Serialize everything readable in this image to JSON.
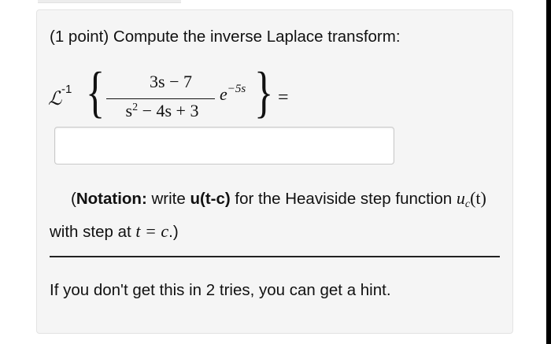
{
  "problem": {
    "prompt": "(1 point) Compute the inverse Laplace transform:",
    "operator": "ℒ",
    "operator_sup": "-1",
    "numerator": "3s − 7",
    "denominator_a": "s",
    "denominator_sup": "2",
    "denominator_b": " − 4s + 3",
    "exp_base": "e",
    "exp_power": "−5s",
    "equals": "="
  },
  "answer": {
    "value": "",
    "placeholder": ""
  },
  "notation": {
    "open": "(",
    "bold_label": "Notation:",
    "text1": " write ",
    "bold_code": "u(t-c)",
    "text2": " for the Heaviside step function ",
    "math_u": "u",
    "math_sub": "c",
    "math_arg": "(t)",
    "text3": " with step at ",
    "math_eq": "t = c",
    "text4": ".)"
  },
  "hint": {
    "text": "If you don't get this in 2 tries, you can get a hint."
  }
}
